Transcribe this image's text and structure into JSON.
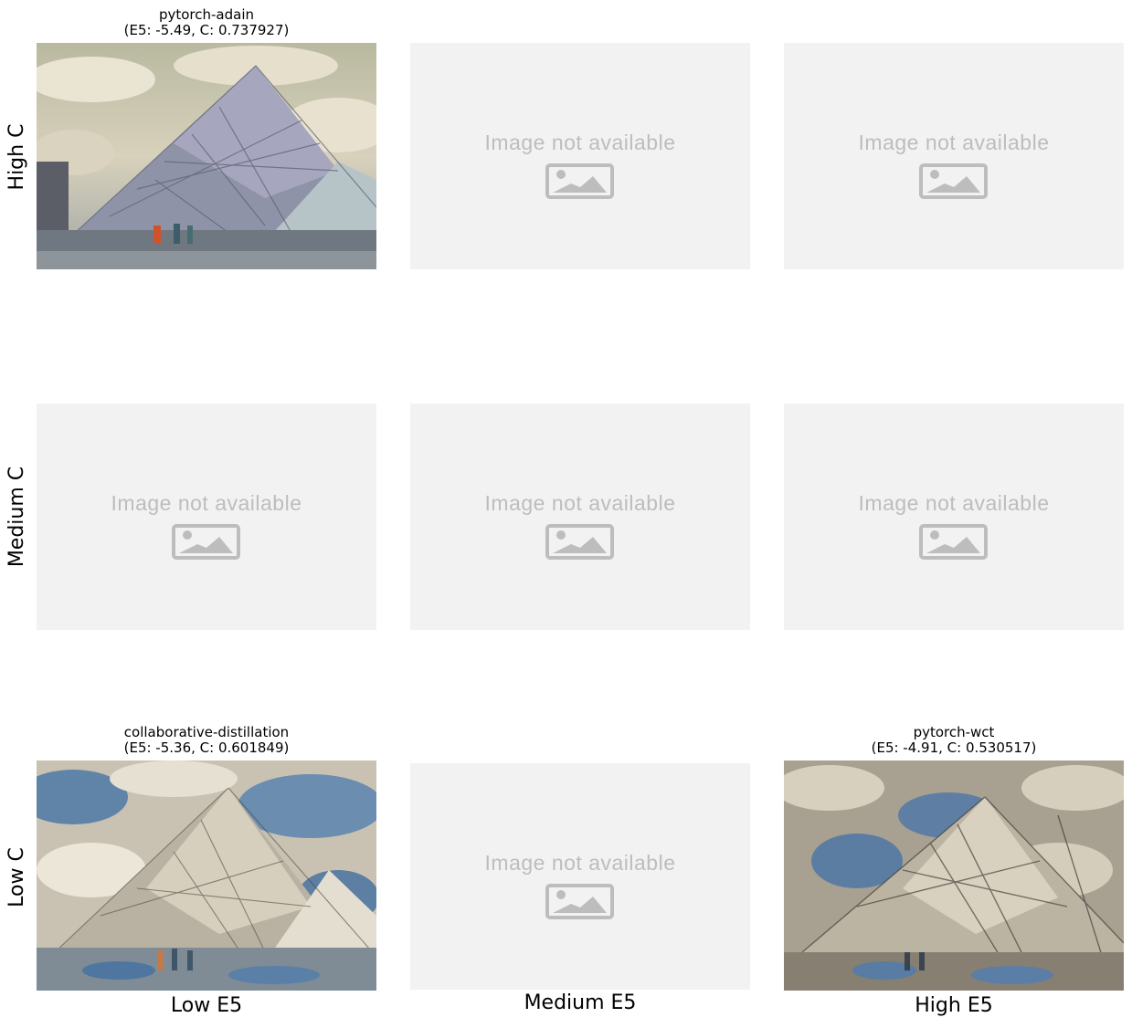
{
  "placeholder_text": "Image not available",
  "placeholder_icon": "image-icon",
  "row_labels": [
    "High C",
    "Medium C",
    "Low C"
  ],
  "col_labels": [
    "Low E5",
    "Medium E5",
    "High E5"
  ],
  "cells": {
    "high_low": {
      "title_line1": "pytorch-adain",
      "title_line2": "(E5: -5.49, C: 0.737927)"
    },
    "low_low": {
      "title_line1": "collaborative-distillation",
      "title_line2": "(E5: -5.36, C: 0.601849)"
    },
    "low_high": {
      "title_line1": "pytorch-wct",
      "title_line2": "(E5: -4.91, C: 0.530517)"
    }
  },
  "colors": {
    "placeholder_bg": "#f2f2f2",
    "placeholder_fg": "#bdbdbd"
  }
}
